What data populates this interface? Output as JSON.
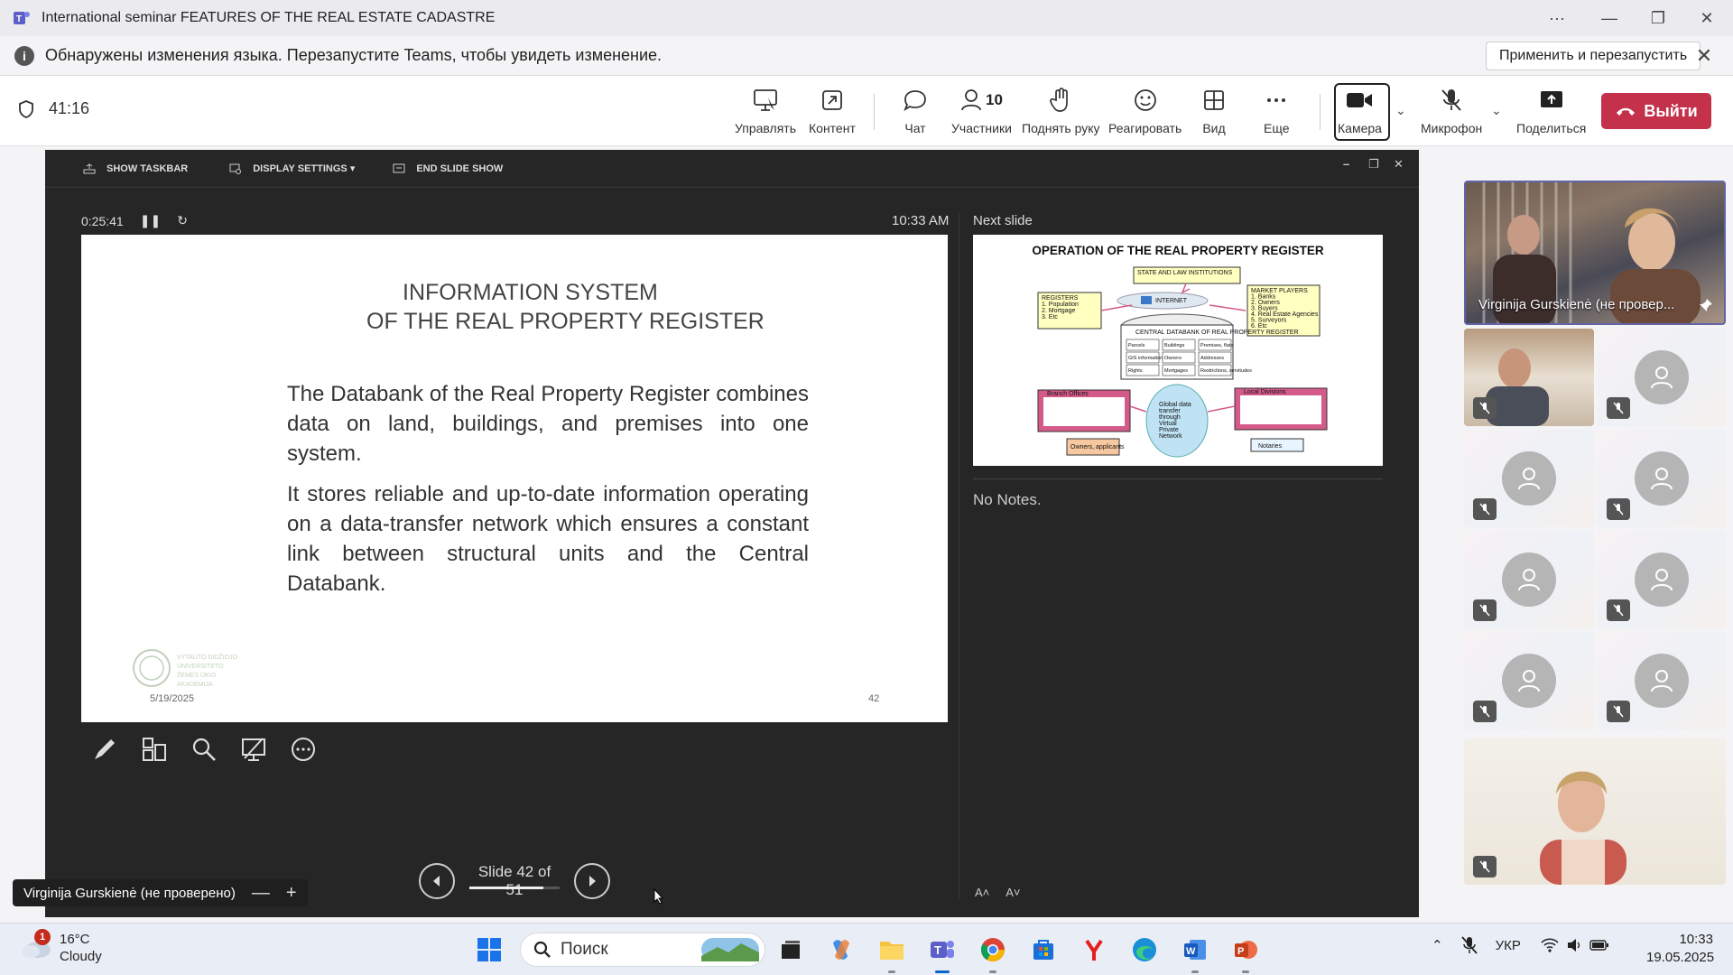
{
  "window": {
    "title": "International seminar FEATURES OF THE REAL ESTATE CADASTRE",
    "more": "···",
    "minimize": "—",
    "maximize": "❐",
    "close": "✕"
  },
  "notification": {
    "text": "Обнаружены изменения языка. Перезапустите Teams, чтобы увидеть изменение.",
    "button": "Применить и перезапустить"
  },
  "meeting": {
    "timer": "41:16",
    "toolbar": {
      "manage": "Управлять",
      "content": "Контент",
      "chat": "Чат",
      "participants": "Участники",
      "participants_count": "10",
      "raise_hand": "Поднять руку",
      "react": "Реагировать",
      "view": "Вид",
      "more": "Еще",
      "camera": "Камера",
      "mic": "Микрофон",
      "share": "Поделиться",
      "leave": "Выйти"
    }
  },
  "presenter": {
    "top": {
      "show_taskbar": "SHOW TASKBAR",
      "display_settings": "DISPLAY SETTINGS ▾",
      "end_show": "END SLIDE SHOW"
    },
    "elapsed": "0:25:41",
    "clock": "10:33 AM",
    "next_slide_label": "Next slide",
    "notes": "No Notes.",
    "slide_counter": "Slide 42 of 51",
    "progress_fraction": 0.82,
    "font_buttons": [
      "A˄",
      "A˅"
    ],
    "current_slide": {
      "title_line1": "INFORMATION SYSTEM",
      "title_line2": "OF THE REAL PROPERTY REGISTER",
      "para1": "The Databank of the Real Property Register combines data on land, buildings, and premises into one system.",
      "para2": "It stores reliable and up-to-date information operating on a data-transfer network which ensures a constant link between structural units and the Central Databank.",
      "date": "5/19/2025",
      "number": "42",
      "logo_text": "VYTAUTO DIDŽIOJO UNIVERSITETO ŽEMĖS ŪKIO AKADEMIJA"
    },
    "next_slide": {
      "title": "OPERATION OF THE REAL PROPERTY REGISTER",
      "state": "STATE AND LAW INSTITUTIONS",
      "registers": [
        "REGISTERS",
        "1. Population",
        "2. Mortgage",
        "3. Etc"
      ],
      "market": [
        "MARKET PLAYERS",
        "1. Banks",
        "2. Owners",
        "3. Buyers",
        "4. Real Estate Agencies",
        "5. Surveyors",
        "6. Etc"
      ],
      "internet": "INTERNET",
      "central": "CENTRAL DATABANK OF REAL PROPERTY REGISTER",
      "cells": [
        "Parcels",
        "Buildings",
        "Premises, flats",
        "GIS information",
        "Owners",
        "Addresses",
        "Rights",
        "Mortgages",
        "Restrictions, servitudes"
      ],
      "branch": "Branch Offices",
      "local": "Local Divisions",
      "working": "Working places",
      "cloud": "Global data transfer through Virtual Private Network",
      "owners": "Owners, applicants",
      "notaries": "Notaries"
    }
  },
  "pill": {
    "name": "Virginija Gurskienė (не проверено)",
    "minus": "—",
    "plus": "+"
  },
  "participants": {
    "featured_name": "Virginija Gurskienė (не провер..."
  },
  "taskbar": {
    "weather_temp": "16°C",
    "weather_desc": "Cloudy",
    "weather_badge": "1",
    "search": "Поиск",
    "lang": "УКР",
    "time": "10:33",
    "date": "19.05.2025"
  },
  "colors": {
    "teams": "#6264a7",
    "leave": "#c4314b",
    "presenter_bg": "#262626",
    "taskbar": "#e9eef6"
  }
}
